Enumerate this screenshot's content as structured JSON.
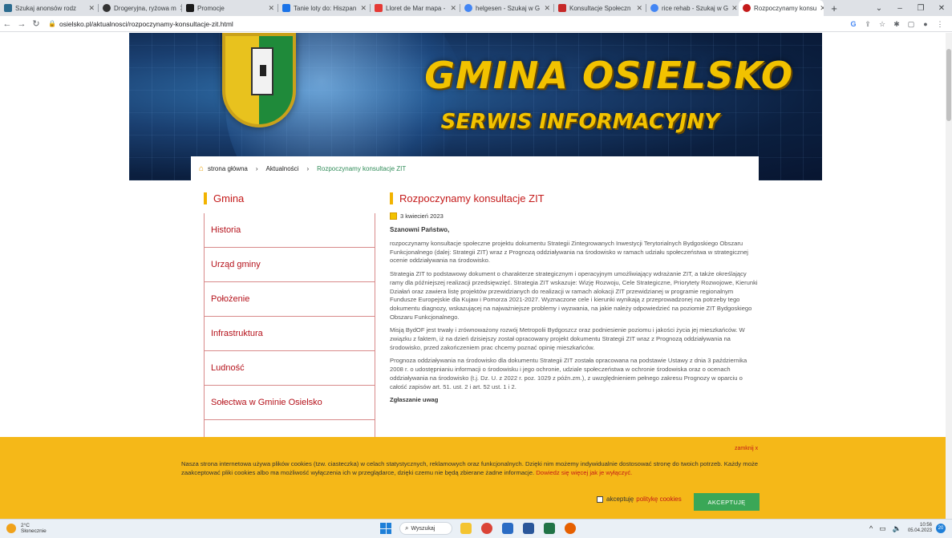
{
  "browser": {
    "tabs": [
      {
        "label": "Szukaj anonsów rodz",
        "color": "#2b6b8f"
      },
      {
        "label": "Drogeryjna, ryżowa m",
        "color": "#333333"
      },
      {
        "label": "Promocje",
        "color": "#1a1a1a"
      },
      {
        "label": "Tanie loty do: Hiszpan",
        "color": "#1a73e8"
      },
      {
        "label": "Lloret de Mar mapa -",
        "color": "#e53935"
      },
      {
        "label": "helgesen - Szukaj w G",
        "color": "#4285f4"
      },
      {
        "label": "Konsultacje Społeczn",
        "color": "#c62828"
      },
      {
        "label": "rice rehab - Szukaj w G",
        "color": "#4285f4"
      },
      {
        "label": "Rozpoczynamy konsu",
        "color": "#c41a1a"
      }
    ],
    "new_tab": "+",
    "url": "osielsko.pl/aktualnosci/rozpoczynamy-konsultacje-zit.html"
  },
  "banner": {
    "title": "GMINA OSIELSKO",
    "subtitle": "SERWIS INFORMACYJNY"
  },
  "breadcrumb": {
    "home": "strona główna",
    "section": "Aktualności",
    "current": "Rozpoczynamy konsultacje ZIT"
  },
  "sidebar": {
    "title": "Gmina",
    "items": [
      "Historia",
      "Urząd gminy",
      "Położenie",
      "Infrastruktura",
      "Ludność",
      "Sołectwa w Gminie Osielsko"
    ]
  },
  "article": {
    "title": "Rozpoczynamy konsultacje ZIT",
    "date": "3 kwiecień 2023",
    "greeting": "Szanowni Państwo,",
    "paragraphs": [
      "rozpoczynamy konsultacje społeczne projektu dokumentu Strategii Zintegrowanych Inwestycji Terytorialnych Bydgoskiego Obszaru Funkcjonalnego (dalej: Strategii ZIT) wraz z Prognozą oddziaływania na środowisko w ramach udziału społeczeństwa w strategicznej ocenie oddziaływania na środowisko.",
      "Strategia ZIT to podstawowy dokument o charakterze strategicznym i operacyjnym umożliwiający wdrażanie ZIT, a także określający ramy dla późniejszej realizacji przedsięwzięć. Strategia ZIT wskazuje: Wizję Rozwoju, Cele Strategiczne, Priorytety Rozwojowe, Kierunki Działań oraz zawiera listę projektów przewidzianych do realizacji w ramach alokacji ZIT przewidzianej w programie regionalnym Fundusze Europejskie dla Kujaw i Pomorza 2021-2027. Wyznaczone cele i kierunki wynikają z przeprowadzonej na potrzeby tego dokumentu diagnozy, wskazującej na najważniejsze problemy i wyzwania, na jakie należy odpowiedzieć na poziomie ZIT Bydgoskiego Obszaru Funkcjonalnego.",
      "Misją BydOF jest trwały i zrównoważony rozwój Metropolii Bydgoszcz oraz podniesienie poziomu i jakości życia jej mieszkańców. W związku z faktem, iż na dzień dzisiejszy został opracowany projekt dokumentu Strategii ZIT wraz z Prognozą oddziaływania na środowisko, przed zakończeniem prac chcemy poznać opinię mieszkańców.",
      "Prognoza oddziaływania na środowisko dla dokumentu Strategii ZIT została opracowana na podstawie Ustawy z dnia 3 października 2008 r. o udostępnianiu informacji o środowisku i jego ochronie, udziale społeczeństwa w ochronie środowiska oraz o ocenach oddziaływania na środowisko (t.j. Dz. U. z 2022 r. poz. 1029 z późn.zm.), z uwzględnieniem pełnego zakresu Prognozy w oparciu o całość zapisów art. 51. ust. 2 i art. 52 ust. 1 i 2."
    ],
    "subhead": "Zgłaszanie uwag"
  },
  "cookie": {
    "close": "zamknij x",
    "message": "Nasza strona internetowa używa plików cookies (tzw. ciasteczka) w celach statystycznych, reklamowych oraz funkcjonalnych. Dzięki nim możemy indywidualnie dostosować stronę do twoich potrzeb. Każdy może zaakceptować pliki cookies albo ma możliwość wyłączenia ich w przeglądarce, dzięki czemu nie będą zbierane żadne informacje.",
    "more": "Dowiedz się więcej jak je wyłączyć.",
    "accept_label": "akceptuję",
    "policy_label": "politykę cookies",
    "button": "AKCEPTUJĘ"
  },
  "taskbar": {
    "temperature": "2°C",
    "weather": "Słonecznie",
    "search": "Wyszukaj",
    "time": "10:56",
    "date": "05.04.2023",
    "notifications": "20"
  }
}
